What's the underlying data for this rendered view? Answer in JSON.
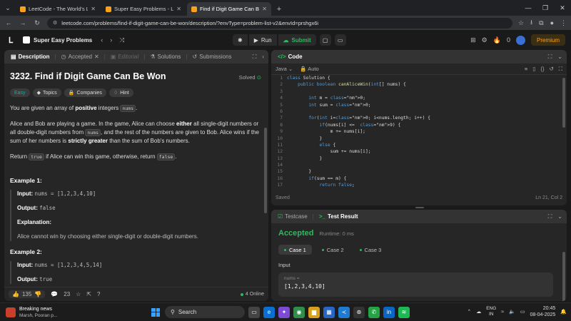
{
  "browser": {
    "tabs": [
      {
        "title": "LeetCode - The World's Leadin",
        "active": false
      },
      {
        "title": "Super Easy Problems - LeetCod",
        "active": false
      },
      {
        "title": "Find if Digit Game Can Be Won",
        "active": true
      }
    ],
    "url": "leetcode.com/problems/find-if-digit-game-can-be-won/description/?envType=problem-list-v2&envId=prshgx6i"
  },
  "lc_nav": {
    "problem_list": "Super Easy Problems",
    "run_label": "Run",
    "submit_label": "Submit",
    "fire_count": "0",
    "premium_label": "Premium"
  },
  "left_tabs": {
    "description": "Description",
    "accepted": "Accepted",
    "editorial": "Editorial",
    "solutions": "Solutions",
    "submissions": "Submissions"
  },
  "problem": {
    "title": "3232. Find if Digit Game Can Be Won",
    "solved": "Solved",
    "tags": [
      "Easy",
      "Topics",
      "Companies",
      "Hint"
    ],
    "p1_a": "You are given an array of ",
    "p1_b": "positive",
    "p1_c": " integers ",
    "p1_code": "nums",
    "p1_d": ".",
    "p2_a": "Alice and Bob are playing a game. In the game, Alice can choose ",
    "p2_b": "either",
    "p2_c": " all single-digit numbers or all double-digit numbers from ",
    "p2_code": "nums",
    "p2_d": ", and the rest of the numbers are given to Bob. Alice wins if the sum of her numbers is ",
    "p2_e": "strictly greater",
    "p2_f": " than the sum of Bob's numbers.",
    "p3_a": "Return ",
    "p3_code1": "true",
    "p3_b": " if Alice can win this game, otherwise, return ",
    "p3_code2": "false",
    "p3_c": ".",
    "examples": [
      {
        "heading": "Example 1:",
        "input_label": "Input:",
        "input": "nums = [1,2,3,4,10]",
        "output_label": "Output:",
        "output": "false",
        "expl_label": "Explanation:",
        "explanation": "Alice cannot win by choosing either single-digit or double-digit numbers."
      },
      {
        "heading": "Example 2:",
        "input_label": "Input:",
        "input": "nums = [1,2,3,4,5,14]",
        "output_label": "Output:",
        "output": "true"
      }
    ]
  },
  "left_footer": {
    "likes": "135",
    "comments": "23",
    "online": "4 Online"
  },
  "code_panel": {
    "title": "Code",
    "language": "Java",
    "mode": "Auto",
    "saved": "Saved",
    "cursor": "Ln 21, Col 2",
    "lines": [
      "class Solution {",
      "    public boolean canAliceWin(int[] nums) {",
      "",
      "        int m = 0;",
      "        int sum = 0;",
      "",
      "        for(int i=0; i<nums.length; i++) {",
      "            if(nums[i] <=  9) {",
      "                m += nums[i];",
      "            }",
      "            else {",
      "                sum += nums[i];",
      "            }",
      "",
      "        }",
      "        if(sum == m) {",
      "            return false;"
    ]
  },
  "test_panel": {
    "testcase_tab": "Testcase",
    "result_tab": "Test Result",
    "status": "Accepted",
    "runtime": "Runtime: 0 ms",
    "cases": [
      "Case 1",
      "Case 2",
      "Case 3"
    ],
    "input_label": "Input",
    "var_name": "nums =",
    "var_value": "[1,2,3,4,10]"
  },
  "taskbar": {
    "news_title": "Breaking news",
    "news_sub": "Marsh, Pooran p...",
    "search": "Search",
    "lang1": "ENG",
    "lang2": "IN",
    "time": "20:45",
    "date": "08-04-2025"
  }
}
